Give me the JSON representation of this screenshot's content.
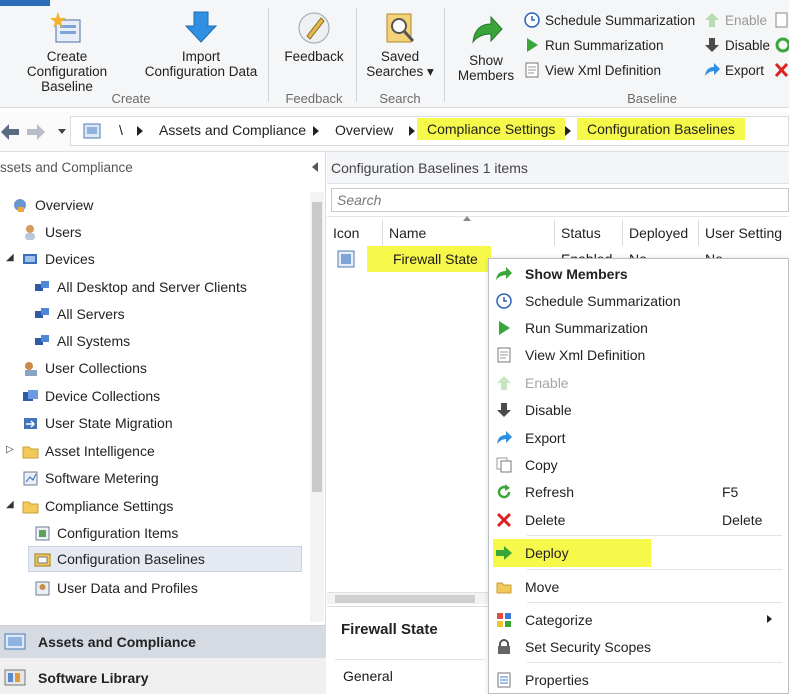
{
  "ribbon": {
    "create_baseline": "Create\nConfiguration Baseline",
    "import_data": "Import\nConfiguration Data",
    "feedback": "Feedback",
    "saved_searches": "Saved\nSearches ▾",
    "show_members": "Show\nMembers",
    "schedule_summarization": "Schedule Summarization",
    "run_summarization": "Run Summarization",
    "view_xml": "View Xml Definition",
    "enable": "Enable",
    "disable": "Disable",
    "export": "Export",
    "groups": {
      "create": "Create",
      "feedback": "Feedback",
      "search": "Search",
      "baseline": "Baseline"
    }
  },
  "address": {
    "root": "\\",
    "crumbs": [
      "Assets and Compliance",
      "Overview",
      "Compliance Settings",
      "Configuration Baselines"
    ]
  },
  "nav": {
    "title": "ssets and Compliance",
    "items": [
      {
        "label": "Overview",
        "icon": "overview-icon"
      },
      {
        "label": "Users",
        "icon": "user-icon"
      },
      {
        "label": "Devices",
        "icon": "devices-icon"
      },
      {
        "label": "All Desktop and Server Clients",
        "icon": "collection-icon"
      },
      {
        "label": "All Servers",
        "icon": "collection-icon"
      },
      {
        "label": "All Systems",
        "icon": "collection-icon"
      },
      {
        "label": "User Collections",
        "icon": "user-collections-icon"
      },
      {
        "label": "Device Collections",
        "icon": "device-collections-icon"
      },
      {
        "label": "User State Migration",
        "icon": "migration-icon"
      },
      {
        "label": "Asset Intelligence",
        "icon": "folder-icon"
      },
      {
        "label": "Software Metering",
        "icon": "metering-icon"
      },
      {
        "label": "Compliance Settings",
        "icon": "folder-icon"
      },
      {
        "label": "Configuration Items",
        "icon": "config-item-icon"
      },
      {
        "label": "Configuration Baselines",
        "icon": "baseline-icon"
      },
      {
        "label": "User Data and Profiles",
        "icon": "profile-icon"
      }
    ],
    "workspaces": [
      "Assets and Compliance",
      "Software Library"
    ]
  },
  "content": {
    "title": "Configuration Baselines 1 items",
    "search_placeholder": "Search",
    "columns": [
      "Icon",
      "Name",
      "Status",
      "Deployed",
      "User Setting"
    ],
    "row": {
      "name": "Firewall State",
      "status": "Enabled",
      "deployed": "No",
      "user_setting": "No"
    },
    "details_title": "Firewall State",
    "details_tab": "General"
  },
  "context_menu": [
    {
      "label": "Show Members",
      "bold": true
    },
    {
      "label": "Schedule Summarization"
    },
    {
      "label": "Run Summarization"
    },
    {
      "label": "View Xml Definition"
    },
    {
      "label": "Enable",
      "disabled": true
    },
    {
      "label": "Disable"
    },
    {
      "label": "Export"
    },
    {
      "label": "Copy"
    },
    {
      "label": "Refresh",
      "shortcut": "F5"
    },
    {
      "label": "Delete",
      "shortcut": "Delete"
    },
    {
      "label": "Deploy"
    },
    {
      "label": "Move"
    },
    {
      "label": "Categorize"
    },
    {
      "label": "Set Security Scopes"
    },
    {
      "label": "Properties"
    }
  ],
  "colors": {
    "highlight": "#f6f84a",
    "accent_blue": "#1e73c8",
    "green": "#3aa63a"
  }
}
